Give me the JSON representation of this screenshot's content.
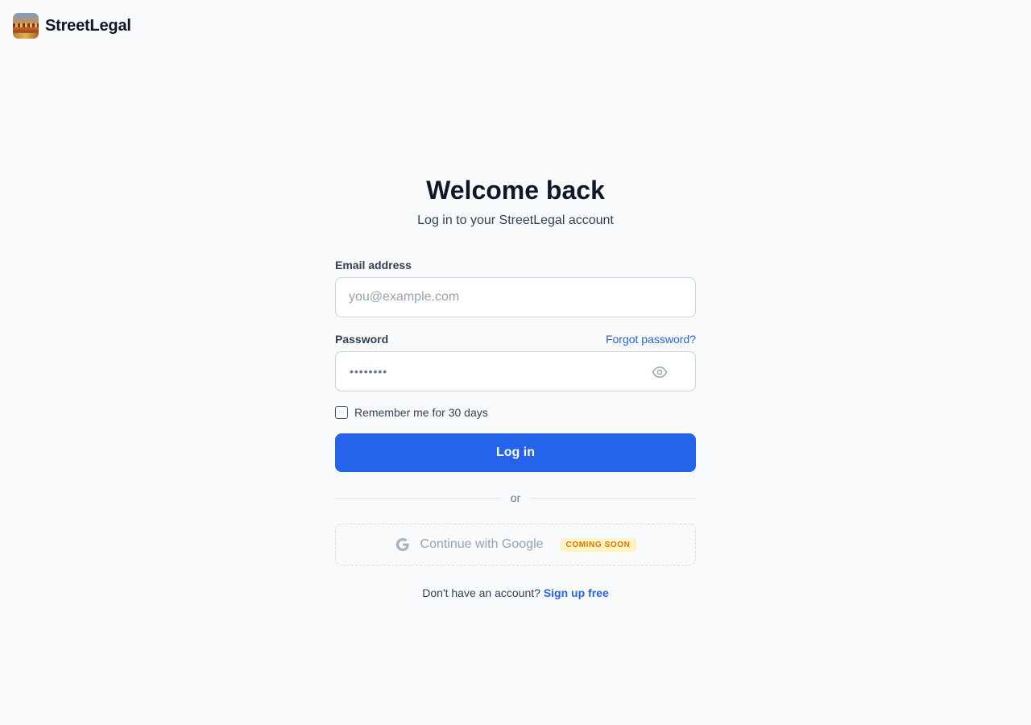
{
  "brand": {
    "name": "StreetLegal",
    "logo_icon": "street-photo-logo"
  },
  "header": {
    "title": "Welcome back",
    "subtitle": "Log in to your StreetLegal account"
  },
  "form": {
    "email_label": "Email address",
    "email_placeholder": "you@example.com",
    "email_value": "",
    "password_label": "Password",
    "forgot_password": "Forgot password?",
    "password_mask": "••••••••",
    "show_password_icon": "eye-icon",
    "remember_label": "Remember me for 30 days",
    "remember_checked": false,
    "submit_label": "Log in"
  },
  "divider": {
    "text": "or"
  },
  "google": {
    "label": "Continue with Google",
    "badge": "COMING SOON",
    "icon": "google-icon",
    "disabled": true
  },
  "footer": {
    "prompt": "Don't have an account?",
    "signup_link": "Sign up free"
  },
  "colors": {
    "background": "#f8fafc",
    "primary": "#2563eb",
    "text": "#0f172a",
    "muted": "#94a3b8",
    "badge_bg": "#fef3c7",
    "badge_text": "#d97706"
  }
}
